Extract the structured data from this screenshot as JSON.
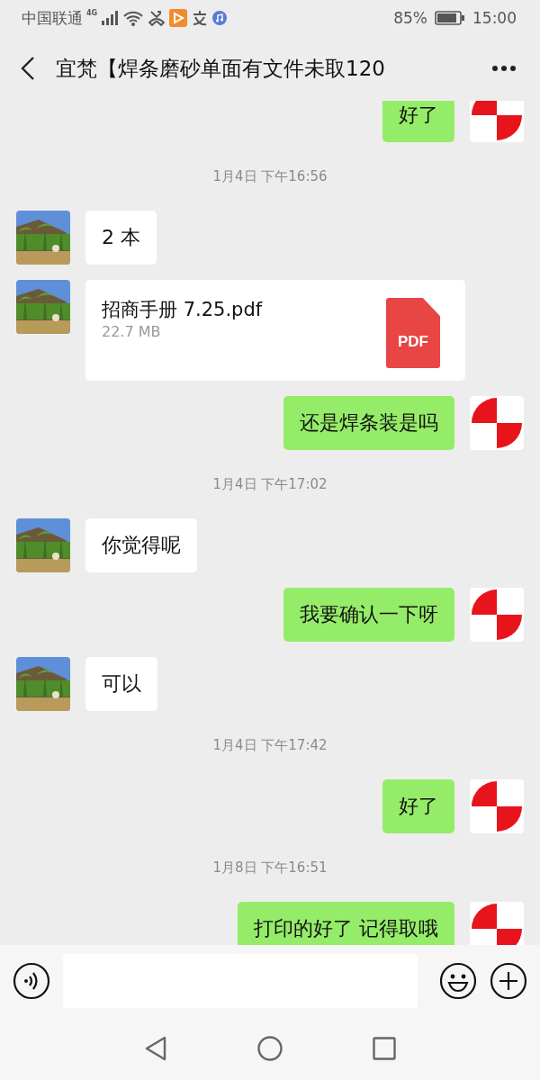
{
  "status_bar": {
    "carrier": "中国联通",
    "network": "4G",
    "battery": "85%",
    "time": "15:00"
  },
  "header": {
    "title": "宜梵【焊条磨砂单面有文件未取120"
  },
  "messages": [
    {
      "kind": "sent",
      "text": "好了"
    },
    {
      "kind": "time",
      "text": "1月4日 下午16:56"
    },
    {
      "kind": "received",
      "text": "2 本"
    },
    {
      "kind": "file",
      "text": "招商手册 7.25.pdf",
      "size": "22.7 MB",
      "file_type": "PDF"
    },
    {
      "kind": "sent",
      "text": "还是焊条装是吗"
    },
    {
      "kind": "time",
      "text": "1月4日 下午17:02"
    },
    {
      "kind": "received",
      "text": "你觉得呢"
    },
    {
      "kind": "sent",
      "text": "我要确认一下呀"
    },
    {
      "kind": "received",
      "text": "可以"
    },
    {
      "kind": "time",
      "text": "1月4日 下午17:42"
    },
    {
      "kind": "sent",
      "text": "好了"
    },
    {
      "kind": "time",
      "text": "1月8日 下午16:51"
    },
    {
      "kind": "sent",
      "text": "打印的好了  记得取哦"
    }
  ]
}
